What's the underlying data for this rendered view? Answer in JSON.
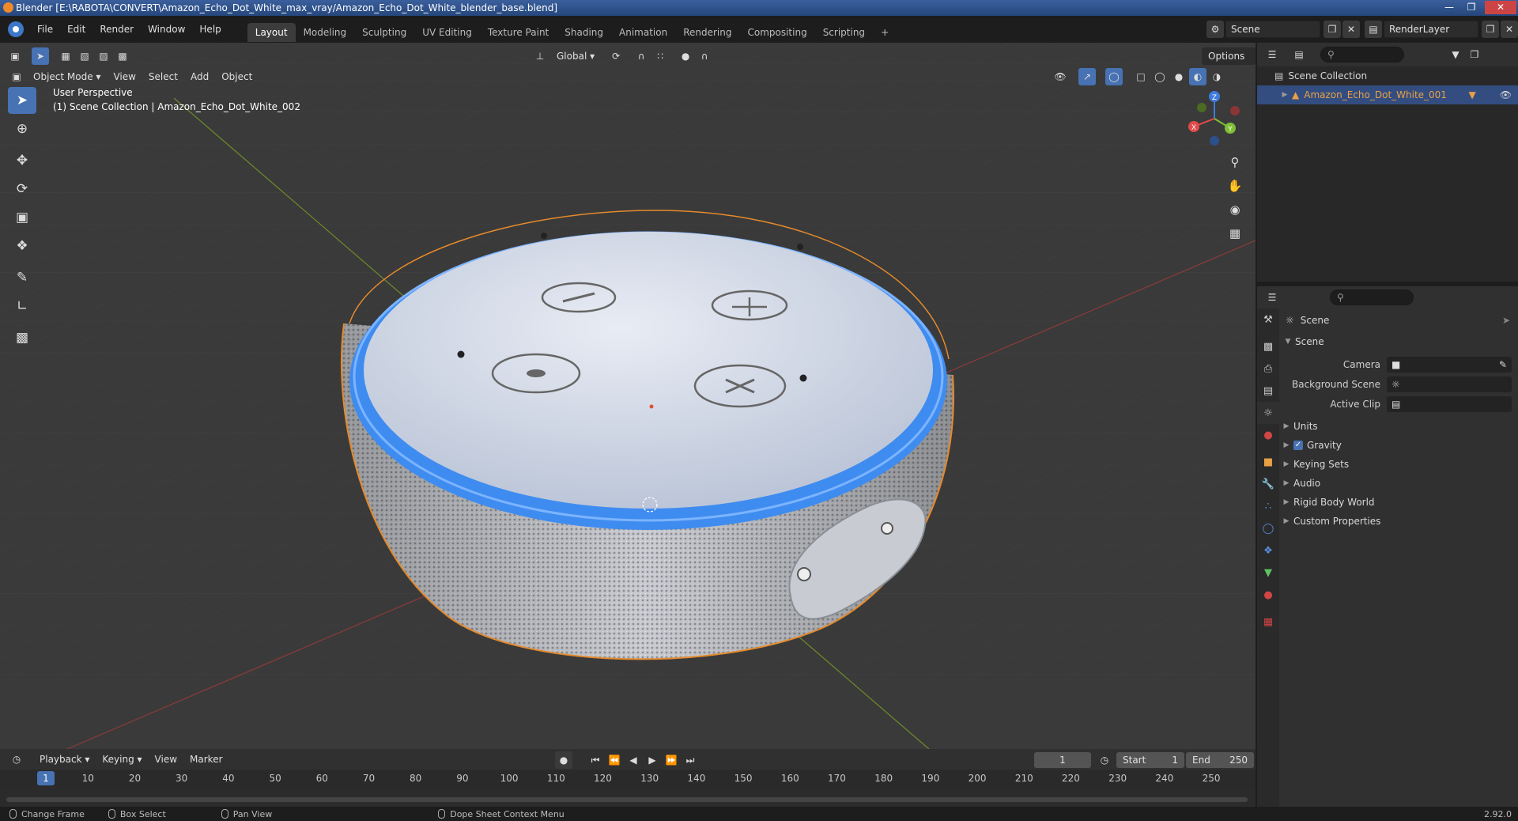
{
  "window": {
    "title": "Blender [E:\\RABOTA\\CONVERT\\Amazon_Echo_Dot_White_max_vray/Amazon_Echo_Dot_White_blender_base.blend]"
  },
  "menu": {
    "items": [
      "File",
      "Edit",
      "Render",
      "Window",
      "Help"
    ]
  },
  "workspaces": {
    "tabs": [
      "Layout",
      "Modeling",
      "Sculpting",
      "UV Editing",
      "Texture Paint",
      "Shading",
      "Animation",
      "Rendering",
      "Compositing",
      "Scripting"
    ],
    "active": "Layout",
    "add": "+"
  },
  "top_right": {
    "scene": "Scene",
    "render_layer": "RenderLayer"
  },
  "viewport": {
    "mode": "Object Mode",
    "menus": [
      "View",
      "Select",
      "Add",
      "Object"
    ],
    "orientation": "Global",
    "options": "Options",
    "info_line1": "User Perspective",
    "info_line2": "(1) Scene Collection | Amazon_Echo_Dot_White_002",
    "gizmo": {
      "x": "X",
      "y": "Y",
      "z": "Z"
    }
  },
  "outliner": {
    "collection": "Scene Collection",
    "object": "Amazon_Echo_Dot_White_001"
  },
  "properties": {
    "context": "Scene",
    "section": "Scene",
    "fields": [
      {
        "label": "Camera",
        "value": ""
      },
      {
        "label": "Background Scene",
        "value": ""
      },
      {
        "label": "Active Clip",
        "value": ""
      }
    ],
    "panels": [
      "Units",
      "Gravity",
      "Keying Sets",
      "Audio",
      "Rigid Body World",
      "Custom Properties"
    ]
  },
  "timeline": {
    "menus": [
      "Playback",
      "Keying",
      "View",
      "Marker"
    ],
    "current_frame": "1",
    "start_label": "Start",
    "start": "1",
    "end_label": "End",
    "end": "250",
    "ticks": [
      "1",
      "10",
      "20",
      "30",
      "40",
      "50",
      "60",
      "70",
      "80",
      "90",
      "100",
      "110",
      "120",
      "130",
      "140",
      "150",
      "160",
      "170",
      "180",
      "190",
      "200",
      "210",
      "220",
      "230",
      "240",
      "250"
    ]
  },
  "statusbar": {
    "items": [
      "Change Frame",
      "Box Select",
      "Pan View",
      "Dope Sheet Context Menu"
    ],
    "version": "2.92.0"
  }
}
